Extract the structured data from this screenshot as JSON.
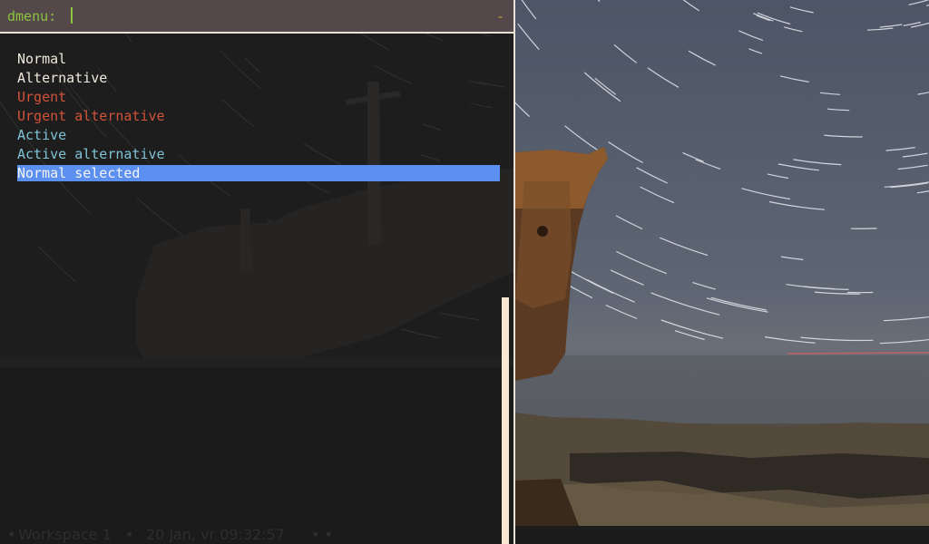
{
  "prompt": {
    "label": "dmenu:",
    "input_value": "",
    "indicator": "-"
  },
  "menu": {
    "items": [
      {
        "label": "Normal",
        "style": "normal"
      },
      {
        "label": "Alternative",
        "style": "alternative"
      },
      {
        "label": "Urgent",
        "style": "urgent"
      },
      {
        "label": "Urgent alternative",
        "style": "urgent-alternative"
      },
      {
        "label": "Active",
        "style": "active"
      },
      {
        "label": "Active alternative",
        "style": "active-alternative"
      },
      {
        "label": "Normal selected",
        "style": "selected"
      }
    ]
  },
  "statusbar": {
    "workspace_dot": "•",
    "workspace": "Workspace 1",
    "sep": "•",
    "datetime": "20 jan, vr 09:32:57",
    "trailing": "• •"
  },
  "colors": {
    "prompt_bg": "#54484a",
    "prompt_fg": "#8cc43e",
    "menu_bg": "#1d1d1d",
    "normal_fg": "#efe8dc",
    "urgent_fg": "#d2533a",
    "active_fg": "#7fc3d6",
    "selected_bg": "#5b8ff0",
    "scrollbar": "#f7e8d4",
    "border": "#e8e2d8"
  },
  "wallpaper": {
    "subject": "shipwreck-under-star-trails"
  }
}
